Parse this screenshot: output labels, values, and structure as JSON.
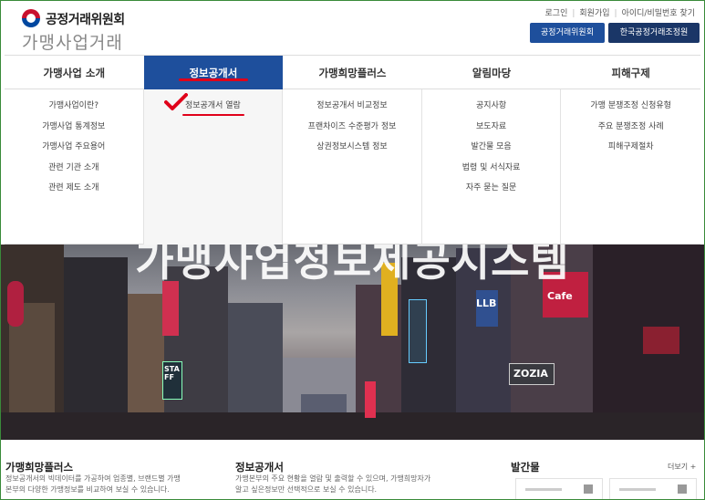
{
  "header": {
    "logo_org": "공정거래위원회",
    "logo_service": "가맹사업거래",
    "util_links": [
      "로그인",
      "회원가입",
      "아이디/비밀번호 찾기"
    ],
    "btn_ftc": "공정거래위원회",
    "btn_kfair": "한국공정거래조정원"
  },
  "nav": {
    "items": [
      {
        "label": "가맹사업 소개"
      },
      {
        "label": "정보공개서"
      },
      {
        "label": "가맹희망플러스"
      },
      {
        "label": "알림마당"
      },
      {
        "label": "피해구제"
      }
    ],
    "active_index": 1
  },
  "dropdown": {
    "col0": [
      "가맹사업이란?",
      "가맹사업 통계정보",
      "가맹사업 주요용어",
      "관련 기관 소개",
      "관련 제도 소개"
    ],
    "col1": [
      "정보공개서 열람"
    ],
    "col2": [
      "정보공개서 비교정보",
      "프랜차이즈 수준평가 정보",
      "상권정보시스템 정보"
    ],
    "col3": [
      "공지사항",
      "보도자료",
      "발간물 모음",
      "법령 및 서식자료",
      "자주 묻는 질문"
    ],
    "col4": [
      "가맹 분쟁조정 신청유형",
      "주요 분쟁조정 사례",
      "피해구제절차"
    ]
  },
  "banner": {
    "title": "가맹사업정보제공시스템",
    "signs": [
      "STAFF",
      "LLB",
      "ZOZIA",
      "Cafe"
    ]
  },
  "bottom": {
    "section1": {
      "title": "가맹희망플러스",
      "desc1": "정보공개서의 빅데이터를 가공하여 업종별, 브랜드별 가맹",
      "desc2": "본부의 다양한 가맹정보를 비교하여 보실 수 있습니다."
    },
    "section2": {
      "title": "정보공개서",
      "desc1": "가맹본부의 주요 현황을 열람 및 출력할 수 있으며, 가맹희망자가",
      "desc2": "알고 싶은정보만 선택적으로 보실 수 있습니다."
    },
    "section3": {
      "title": "발간물",
      "more": "더보기 +"
    }
  },
  "colors": {
    "nav_active": "#1e4f9c",
    "btn_ftc": "#1e4f9c",
    "btn_kfair": "#1a3667",
    "highlight_red": "#e0001a"
  }
}
